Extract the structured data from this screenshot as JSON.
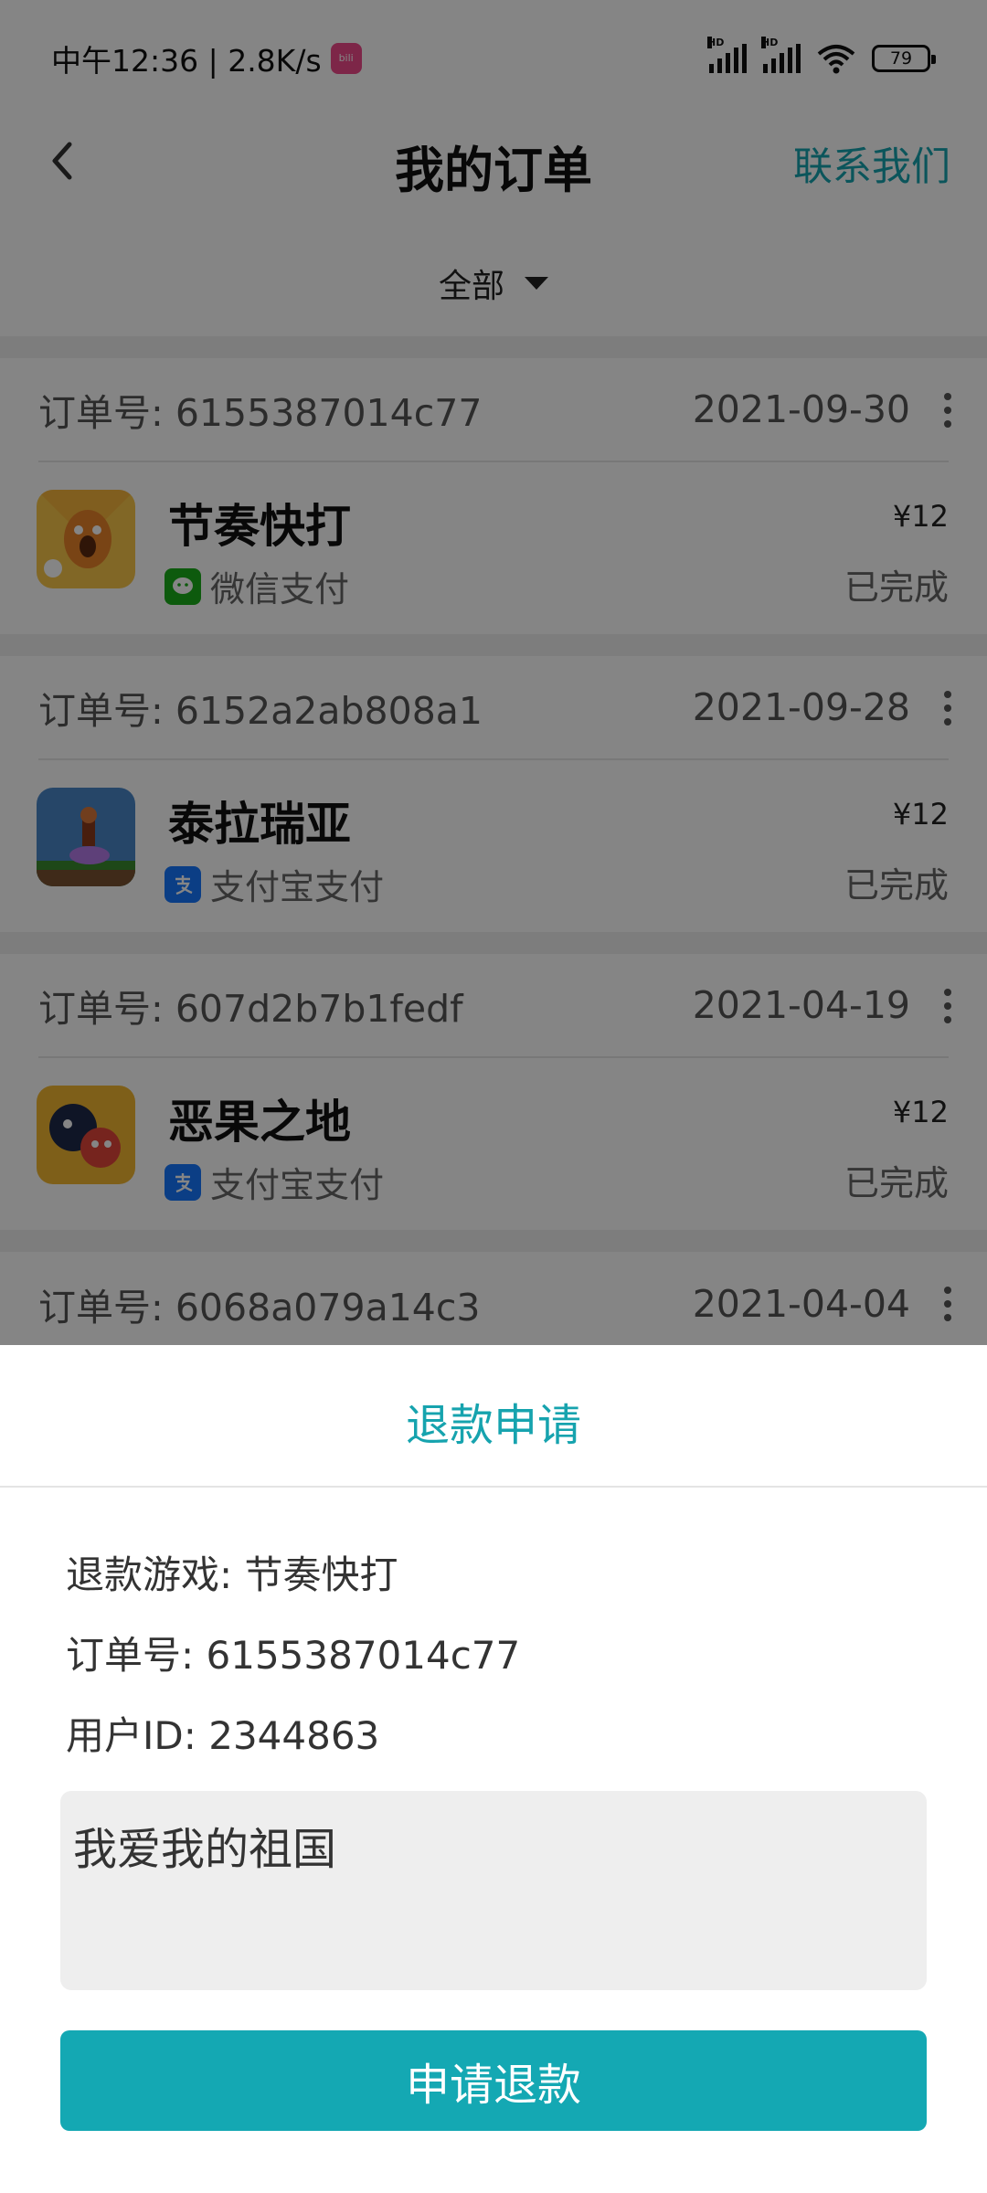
{
  "status_bar": {
    "time_speed": "中午12:36 | 2.8K/s",
    "battery": "79",
    "signal_label": "HD",
    "app_badge_text": "bili"
  },
  "header": {
    "title": "我的订单",
    "contact_label": "联系我们",
    "back_icon": "chevron-left-icon"
  },
  "filter": {
    "label": "全部"
  },
  "orders": [
    {
      "order_no": "订单号: 6155387014c77",
      "date": "2021-09-30",
      "game": "节奏快打",
      "payment": "微信支付",
      "payment_icon": "wechat-pay-icon",
      "price": "¥12",
      "status": "已完成"
    },
    {
      "order_no": "订单号: 6152a2ab808a1",
      "date": "2021-09-28",
      "game": "泰拉瑞亚",
      "payment": "支付宝支付",
      "payment_icon": "alipay-icon",
      "price": "¥12",
      "status": "已完成"
    },
    {
      "order_no": "订单号: 607d2b7b1fedf",
      "date": "2021-04-19",
      "game": "恶果之地",
      "payment": "支付宝支付",
      "payment_icon": "alipay-icon",
      "price": "¥12",
      "status": "已完成"
    },
    {
      "order_no": "订单号: 6068a079a14c3",
      "date": "2021-04-04"
    }
  ],
  "refund_sheet": {
    "title": "退款申请",
    "game_line": "退款游戏:  节奏快打",
    "order_line": "订单号:  6155387014c77",
    "user_line": "用户ID:  2344863",
    "reason_value": "我爱我的祖国",
    "submit_label": "申请退款"
  },
  "colors": {
    "accent": "#16a3ae",
    "button": "#14a8b3",
    "wechat": "#1aad19",
    "alipay": "#1677ff"
  }
}
